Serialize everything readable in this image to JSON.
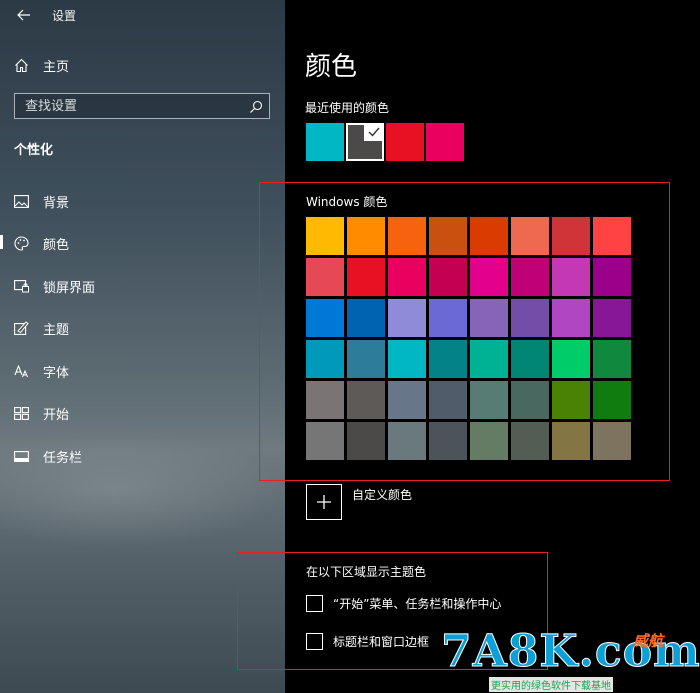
{
  "window": {
    "title": "设置"
  },
  "sidebar": {
    "home_label": "主页",
    "search_placeholder": "查找设置",
    "section_heading": "个性化",
    "items": [
      {
        "label": "背景",
        "icon": "picture-icon"
      },
      {
        "label": "颜色",
        "icon": "palette-icon",
        "active": true
      },
      {
        "label": "锁屏界面",
        "icon": "lock-screen-icon"
      },
      {
        "label": "主题",
        "icon": "theme-brush-icon"
      },
      {
        "label": "字体",
        "icon": "font-icon"
      },
      {
        "label": "开始",
        "icon": "start-grid-icon"
      },
      {
        "label": "任务栏",
        "icon": "taskbar-icon"
      }
    ]
  },
  "main": {
    "title": "颜色",
    "recent_label": "最近使用的颜色",
    "recent_colors": [
      "#00b7c3",
      "#4c4a48",
      "#e81123",
      "#ea005e"
    ],
    "recent_selected_index": 1,
    "windows_colors_label": "Windows 颜色",
    "windows_colors": [
      [
        "#ffb900",
        "#ff8c00",
        "#f7630c",
        "#ca5010",
        "#da3b01",
        "#ef6950",
        "#d13438",
        "#ff4343"
      ],
      [
        "#e74856",
        "#e81123",
        "#ea005e",
        "#c30052",
        "#e3008c",
        "#bf0077",
        "#c239b3",
        "#9a0089"
      ],
      [
        "#0078d7",
        "#0063b1",
        "#8e8cd8",
        "#6b69d6",
        "#8764b8",
        "#744da9",
        "#b146c2",
        "#881798"
      ],
      [
        "#0099bc",
        "#2d7d9a",
        "#00b7c3",
        "#038387",
        "#00b294",
        "#018574",
        "#00cc6a",
        "#10893e"
      ],
      [
        "#7a7574",
        "#5d5a58",
        "#68768a",
        "#515c6b",
        "#567c73",
        "#486860",
        "#498205",
        "#107c10"
      ],
      [
        "#767676",
        "#4c4a48",
        "#69797e",
        "#4a5459",
        "#647c64",
        "#525e54",
        "#847545",
        "#7e735f"
      ]
    ],
    "custom_color_label": "自定义颜色",
    "show_accent_label": "在以下区域显示主题色",
    "checkboxes": [
      {
        "label": "“开始”菜单、任务栏和操作中心",
        "checked": false
      },
      {
        "label": "标题栏和窗口边框",
        "checked": false
      }
    ]
  },
  "watermark": {
    "main": "7A8K.com",
    "badge": "威航",
    "sub": "更实用的绿色软件下载基地"
  }
}
